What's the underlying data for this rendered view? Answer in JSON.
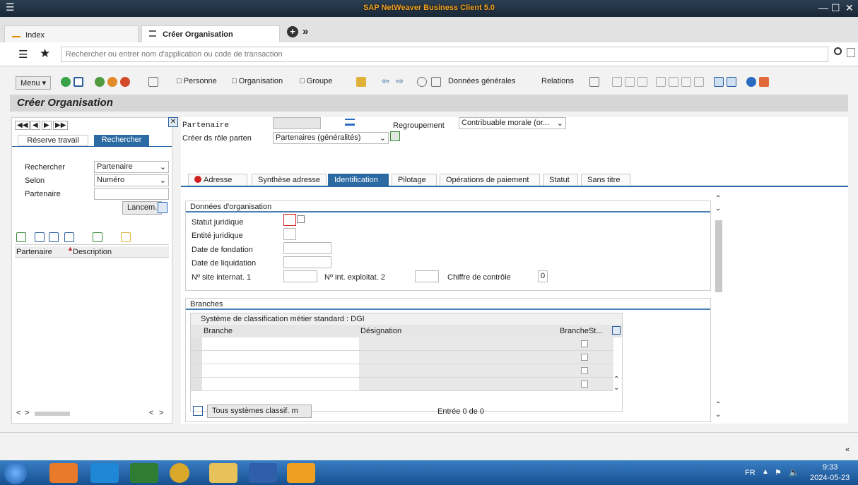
{
  "window": {
    "title": "SAP NetWeaver Business Client 5.0"
  },
  "tabs": [
    {
      "label": "Index"
    },
    {
      "label": "Créer Organisation"
    }
  ],
  "search": {
    "placeholder": "Rechercher ou entrer nom d'application ou code de transaction"
  },
  "toolbar": {
    "menu": "Menu",
    "personne": "Personne",
    "organisation": "Organisation",
    "groupe": "Groupe",
    "donnees": "Données générales",
    "relations": "Relations"
  },
  "page_title": "Créer Organisation",
  "left": {
    "tab_reserve": "Réserve travail",
    "tab_rechercher": "Rechercher",
    "rechercher_label": "Rechercher",
    "rechercher_value": "Partenaire",
    "selon_label": "Selon",
    "selon_value": "Numéro",
    "partenaire_label": "Partenaire",
    "lancer": "Lancem.",
    "col_partenaire": "Partenaire",
    "col_description": "Description"
  },
  "header": {
    "partenaire_label": "Partenaire",
    "regroupement_label": "Regroupement",
    "regroupement_value": "Contribuable morale (or...",
    "role_label": "Créer ds rôle parten",
    "role_value": "Partenaires (généralités)"
  },
  "main_tabs": [
    {
      "label": "Adresse"
    },
    {
      "label": "Synthèse adresse"
    },
    {
      "label": "Identification"
    },
    {
      "label": "Pilotage"
    },
    {
      "label": "Opérations de paiement"
    },
    {
      "label": "Statut"
    },
    {
      "label": "Sans titre"
    }
  ],
  "org": {
    "title": "Données d'organisation",
    "statut": "Statut juridique",
    "entite": "Entité juridique",
    "fondation": "Date de fondation",
    "liquidation": "Date de liquidation",
    "site1": "Nº site internat. 1",
    "site2": "Nº int. exploitat. 2",
    "chiffre": "Chiffre de contrôle",
    "chiffre_value": "0"
  },
  "branches": {
    "title": "Branches",
    "system": "Système de classification métier standard :  DGI",
    "col_branche": "Branche",
    "col_designation": "Désignation",
    "col_branchest": "BrancheSt...",
    "all_btn": "Tous systèmes classif. m",
    "entry": "Entrée 0 de 0"
  },
  "taskbar": {
    "lang": "FR",
    "time": "9:33",
    "date": "2024-05-23"
  }
}
